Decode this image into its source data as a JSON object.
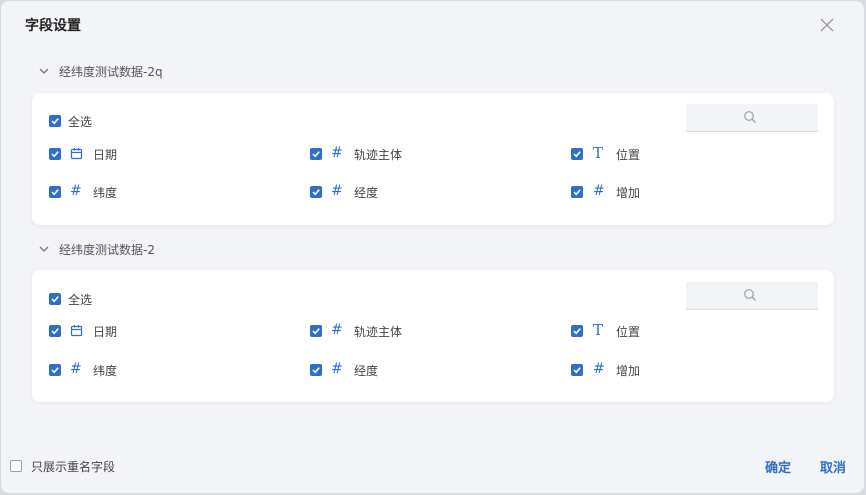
{
  "dialog": {
    "title": "字段设置",
    "close_icon": "close-icon"
  },
  "sections": [
    {
      "name": "经纬度测试数据-2q",
      "select_all": {
        "label": "全选",
        "checked": true
      },
      "search": {
        "placeholder": ""
      },
      "fields": [
        {
          "label": "日期",
          "type": "date",
          "icon": "calendar-icon",
          "checked": true
        },
        {
          "label": "轨迹主体",
          "type": "number",
          "icon": "hash-icon",
          "checked": true
        },
        {
          "label": "位置",
          "type": "text",
          "icon": "text-type-icon",
          "checked": true
        },
        {
          "label": "纬度",
          "type": "number",
          "icon": "hash-icon",
          "checked": true
        },
        {
          "label": "经度",
          "type": "number",
          "icon": "hash-icon",
          "checked": true
        },
        {
          "label": "增加",
          "type": "number",
          "icon": "hash-icon",
          "checked": true
        }
      ]
    },
    {
      "name": "经纬度测试数据-2",
      "select_all": {
        "label": "全选",
        "checked": true
      },
      "search": {
        "placeholder": ""
      },
      "fields": [
        {
          "label": "日期",
          "type": "date",
          "icon": "calendar-icon",
          "checked": true
        },
        {
          "label": "轨迹主体",
          "type": "number",
          "icon": "hash-icon",
          "checked": true
        },
        {
          "label": "位置",
          "type": "text",
          "icon": "text-type-icon",
          "checked": true
        },
        {
          "label": "纬度",
          "type": "number",
          "icon": "hash-icon",
          "checked": true
        },
        {
          "label": "经度",
          "type": "number",
          "icon": "hash-icon",
          "checked": true
        },
        {
          "label": "增加",
          "type": "number",
          "icon": "hash-icon",
          "checked": true
        }
      ]
    }
  ],
  "footer": {
    "show_duplicates": {
      "label": "只展示重名字段",
      "checked": false
    },
    "confirm_label": "确定",
    "cancel_label": "取消"
  },
  "colors": {
    "accent": "#2f6ec9",
    "dialog_bg": "#f3f4f7",
    "card_bg": "#ffffff"
  }
}
